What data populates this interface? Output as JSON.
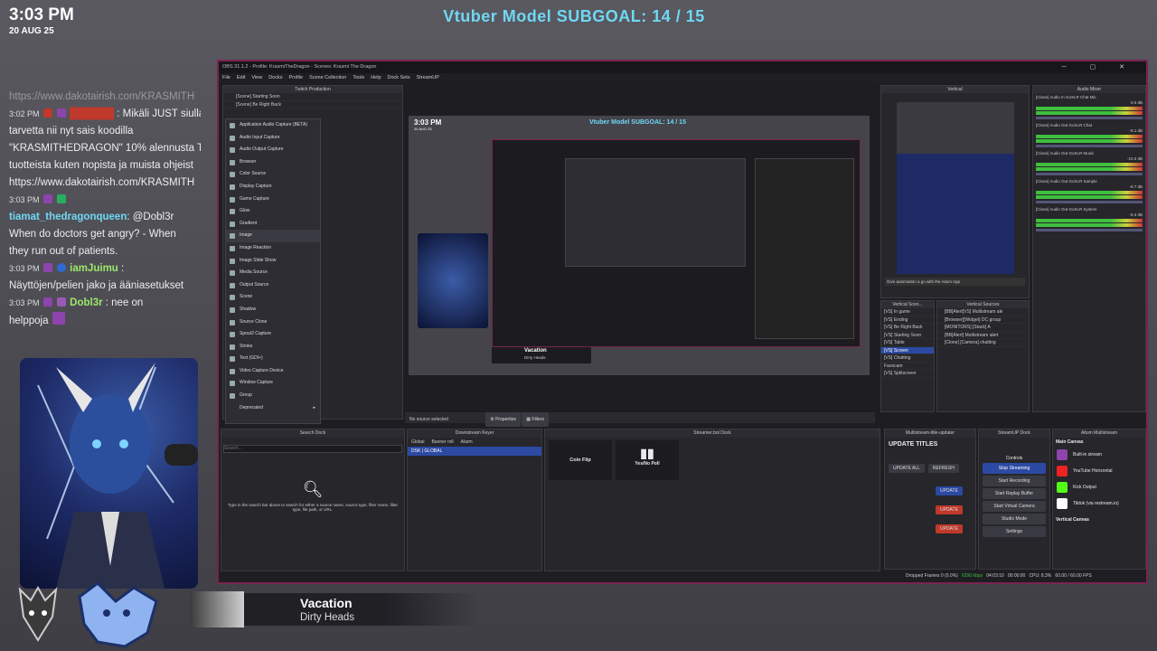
{
  "overlay": {
    "time": "3:03 PM",
    "date": "20 AUG 25",
    "subgoal": "Vtuber Model SUBGOAL: 14 / 15"
  },
  "chat": {
    "lines": [
      {
        "text": "https://www.dakotairish.com/KRASMITH"
      },
      {
        "meta": "3:02 PM",
        "user": "",
        "text": ": Mikäli JUST siulla"
      },
      {
        "text": "tarvetta nii nyt sais koodilla"
      },
      {
        "text": "\"KRASMITHEDRAGON\" 10% alennusta T"
      },
      {
        "text": "tuotteista kuten nopista ja muista ohjeist"
      },
      {
        "text": "https://www.dakotairish.com/KRASMITH"
      },
      {
        "meta": "3:03 PM",
        "user": "",
        "text": ""
      },
      {
        "user": "tiamat_thedragonqueen",
        "text": ": @Dobl3r"
      },
      {
        "text": "When do doctors get angry? - When"
      },
      {
        "text": "they run out of patients."
      },
      {
        "meta": "3:03 PM",
        "user": "iamJuimu",
        "text": ":"
      },
      {
        "text": "Näyttöjen/pelien jako ja ääniasetukset"
      },
      {
        "meta": "3:03 PM",
        "user": "Dobl3r",
        "text": ": nee on"
      },
      {
        "text": "helppoja"
      }
    ],
    "colors": {
      "tiamat": "#6fd8f5",
      "iamJuimu": "#9ee86a",
      "Dobl3r": "#9ee86a"
    }
  },
  "song": {
    "title": "Vacation",
    "artist": "Dirty Heads"
  },
  "obs": {
    "title": "OBS 31.1.2 - Profile: KrasmiTheDragon - Scenes: Krasmi The Dragon",
    "menu": [
      "File",
      "Edit",
      "View",
      "Docks",
      "Profile",
      "Scene Collection",
      "Tools",
      "Help",
      "Dock Sets",
      "StreamUP"
    ],
    "scenes_header": "Twitch Production",
    "scenes": [
      "[Scene] Starting Soon",
      "[Scene] Be Right Back"
    ],
    "context_menu": [
      "Application Audio Capture (BETA)",
      "Audio Input Capture",
      "Audio Output Capture",
      "Browser",
      "Color Source",
      "Display Capture",
      "Game Capture",
      "Glow",
      "Gradient",
      "Image",
      "Image Reaction",
      "Image Slide Show",
      "Media Source",
      "Output Source",
      "Scene",
      "Shadow",
      "Source Clone",
      "Spout2 Capture",
      "Stroke",
      "Text (GDI+)",
      "Video Capture Device",
      "Window Capture",
      "Group",
      "Deprecated"
    ],
    "preview": {
      "time": "3:03 PM",
      "date": "20 AUG 25",
      "goal": "Vtuber Model SUBGOAL: 14 / 15",
      "song_title": "Vacation",
      "song_artist": "Dirty Heads"
    },
    "no_source": "No source selected",
    "properties_label": "Properties",
    "filters_label": "Filters",
    "search_dock": {
      "title": "Search Dock",
      "placeholder": "Search...",
      "hint": "Type in the search bar above to search for either a source name, source type, filter name, filter type, file path, or URL."
    },
    "dsk": {
      "title": "Downstream Keyer",
      "tabs": [
        "Global",
        "Banner roll",
        "Alarm"
      ],
      "item": "DSK | GLOBAL"
    },
    "streamerbot": {
      "title": "Streamer.bot Dock",
      "coin_flip": "Coin Flip",
      "poll": "Yes/No Poll"
    },
    "vertical": {
      "title": "Vertical",
      "automation": "Give automation a go with the Aitum App"
    },
    "vertical_scenes": {
      "title": "Vertical Scen...",
      "items": [
        "[VS] In game",
        "[VS] Ending",
        "[VS] Be Right Back",
        "[VS] Starting Soon",
        "[VS] Table",
        "[VS] Screen",
        "[VS] Chatting",
        "Facecam",
        "[VS] Splitscreen"
      ]
    },
    "vertical_sources": {
      "title": "Vertical Sources",
      "items": [
        "[BB]Alert[VS] Multistream ale",
        "[Browser][Widget] DC group",
        "[MONITORS] [Stack] A",
        "[BB]Alert] Multistream alert",
        "[Clone] [Camera] chatting"
      ]
    },
    "audio_mixer": {
      "title": "Audio Mixer",
      "channels": [
        {
          "name": "[Clone] Audio In GoXLR Chat Mic",
          "db": "0.0 dB"
        },
        {
          "name": "[Clone] Audio Out GoXLR Chat",
          "db": "-8.1 dB"
        },
        {
          "name": "[Clone] Audio Out GoXLR Music",
          "db": "-10.0 dB"
        },
        {
          "name": "[Clone] Audio Out GoXLR Sample",
          "db": "-8.7 dB"
        },
        {
          "name": "[Clone] Audio Out GoXLR System",
          "db": "-8.3 dB"
        }
      ]
    },
    "multistream_updater": {
      "title": "Multistream-title-updater",
      "heading": "UPDATE TITLES",
      "update_all": "UPDATE ALL",
      "refresh": "REFRESH",
      "update": "UPDATE"
    },
    "streamup": {
      "title": "StreamUP Dock",
      "controls": "Controls",
      "buttons": [
        "Stop Streaming",
        "Start Recording",
        "Start Replay Buffer",
        "Start Virtual Camera",
        "Studio Mode",
        "Settings"
      ]
    },
    "aitum": {
      "title": "Aitum Multistream",
      "main_canvas": "Main Canvas",
      "outputs": [
        "Built-in stream",
        "YouTube Horizontal",
        "Kick Output",
        "Tiktok (via restream.io)"
      ],
      "vertical_canvas": "Vertical Canvas"
    },
    "status": {
      "dropped": "Dropped Frames 0 (0.0%)",
      "kbps": "6290 kbps",
      "time1": "04:03:10",
      "time2": "00:00:00",
      "cpu": "CPU: 8.3%",
      "fps": "60.00 / 60.00 FPS"
    }
  }
}
